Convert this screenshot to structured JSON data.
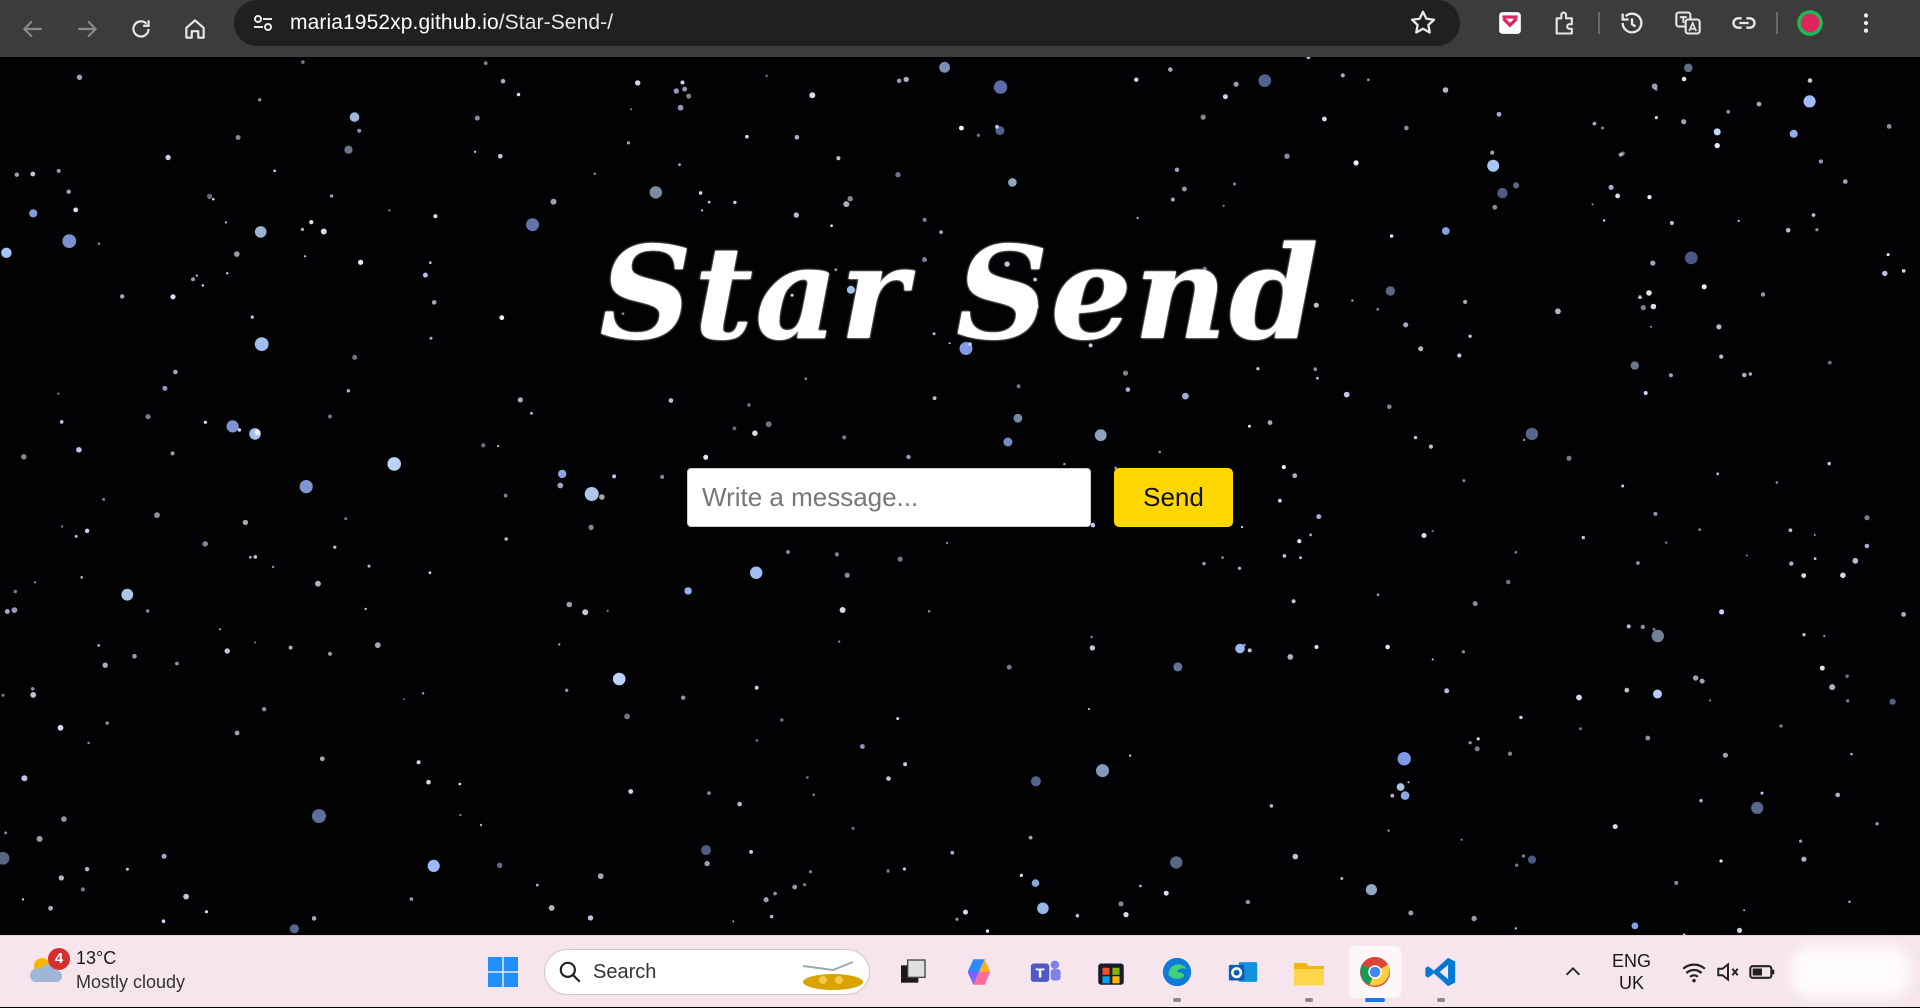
{
  "browser": {
    "url_host": "maria1952xp.github.io",
    "url_path": "/Star-Send-/"
  },
  "page": {
    "title": "Star Send",
    "input_placeholder": "Write a message...",
    "send_label": "Send"
  },
  "taskbar": {
    "weather_badge": "4",
    "weather_temp": "13°C",
    "weather_desc": "Mostly cloudy",
    "search_label": "Search",
    "lang_line1": "ENG",
    "lang_line2": "UK"
  },
  "colors": {
    "send_button": "#ffd700",
    "chrome_bar": "#3c3c3c",
    "taskbar": "#f7e5ee"
  }
}
